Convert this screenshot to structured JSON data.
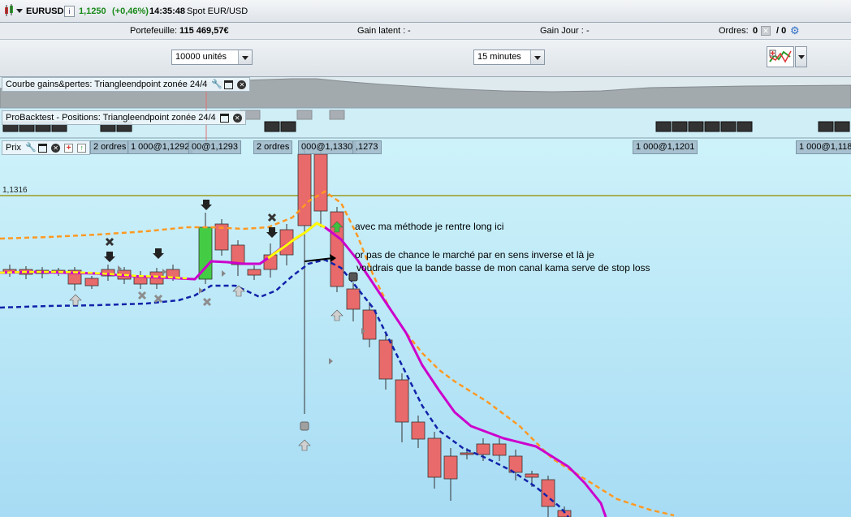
{
  "header": {
    "symbol": "EURUSD",
    "price": "1,1250",
    "change": "(+0,46%)",
    "time": "14:35:48",
    "instrument": "Spot EUR/USD"
  },
  "info": {
    "portfolio_label": "Portefeuille:",
    "portfolio_value": "115 469,57€",
    "gain_latent_label": "Gain latent :",
    "gain_latent_value": "-",
    "gain_jour_label": "Gain Jour :",
    "gain_jour_value": "-",
    "ordres_label": "Ordres:",
    "ordres_value": "0",
    "ordres_total": "/ 0"
  },
  "controls": {
    "units": "10000 unités",
    "timeframe": "15 minutes"
  },
  "panels": {
    "equity_label": "Courbe gains&pertes: Triangleendpoint zonée 24/4",
    "positions_label": "ProBacktest - Positions: Triangleendpoint zonée 24/4",
    "price_label": "Prix"
  },
  "order_tags": [
    "2 ordres",
    "1 000@1,1292",
    "00@1,1293",
    "2 ordres",
    "000@1,1330",
    ",1273",
    "1 000@1,1201",
    "1 000@1,118"
  ],
  "price_level": "1,1316",
  "annotations": {
    "line1": "avec ma méthode je rentre long ici",
    "line2": "or  pas de chance le marché par en sens inverse et là je",
    "line3": "voudrais que la bande basse de mon canal kama serve de stop loss"
  },
  "colors": {
    "bull": "#44cc44",
    "bear": "#e86a6a",
    "kama": "#cc00cc",
    "kama_bull": "#ffff00",
    "upper_band": "#ff9922",
    "lower_band": "#1122aa",
    "price_gain": "#1a8a1a"
  }
}
